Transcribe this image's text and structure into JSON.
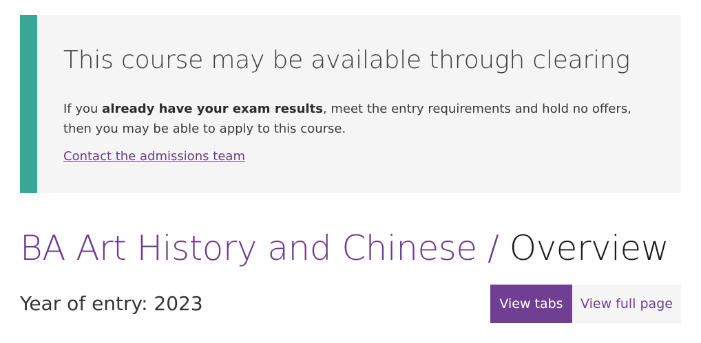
{
  "clearing": {
    "heading": "This course may be available through clearing",
    "text_prefix": "If you ",
    "text_bold": "already have your exam results",
    "text_suffix": ", meet the entry requirements and hold no offers, then you may be able to apply to this course.",
    "link_label": "Contact the admissions team",
    "accent_color": "#3aa796"
  },
  "course": {
    "name": "BA Art History and Chinese",
    "separator": " / ",
    "section": "Overview",
    "year_label": "Year of entry: 2023"
  },
  "view_toggle": {
    "active_label": "View tabs",
    "inactive_label": "View full page",
    "brand_color": "#6e3f92"
  }
}
